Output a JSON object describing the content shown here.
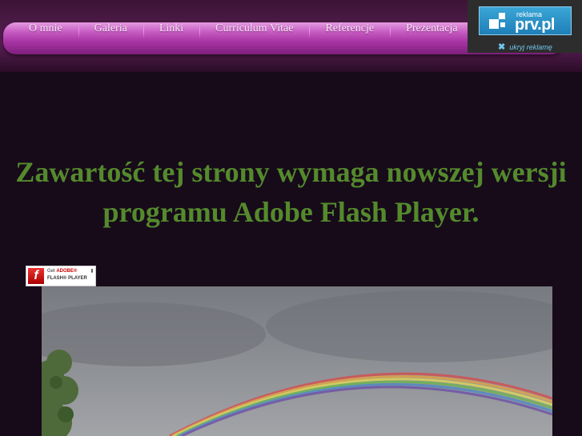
{
  "nav": {
    "items": [
      {
        "label": "O mnie"
      },
      {
        "label": "Galeria"
      },
      {
        "label": "Linki"
      },
      {
        "label": "Curriculum Vitae"
      },
      {
        "label": "Referencje"
      },
      {
        "label": "Prezentacja"
      }
    ]
  },
  "ad": {
    "label": "reklama",
    "brand": "prv.pl",
    "hide_label": "ukryj reklamę"
  },
  "content": {
    "message_line1": "Zawartość tej strony wymaga nowszej wersji",
    "message_line2": "programu Adobe Flash Player."
  },
  "flash_badge": {
    "line1_prefix": "Get",
    "line1_brand": "ADOBE®",
    "line2": "FLASH® PLAYER"
  },
  "colors": {
    "page_bg": "#170b1a",
    "nav_accent": "#a834a4",
    "message": "#548a2c",
    "ad_accent": "#1f7fb8"
  }
}
